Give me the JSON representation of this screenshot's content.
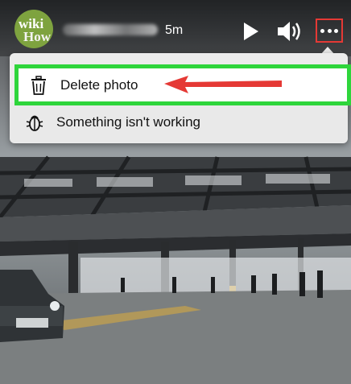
{
  "header": {
    "avatar": {
      "logo_line1": "wiki",
      "logo_line2": "How"
    },
    "time_ago": "5m",
    "controls": [
      {
        "name": "play",
        "icon": "play-icon"
      },
      {
        "name": "volume",
        "icon": "speaker-icon"
      },
      {
        "name": "more",
        "icon": "more-horizontal-icon"
      }
    ]
  },
  "menu": {
    "items": [
      {
        "label": "Delete photo",
        "icon": "trash-icon",
        "highlighted": true
      },
      {
        "label": "Something isn't working",
        "icon": "bug-icon",
        "highlighted": false
      }
    ]
  },
  "colors": {
    "highlight_border": "#2ed53b",
    "annotation_arrow": "#e53935",
    "more_button_outline": "#e53935",
    "menu_background": "#ececec"
  }
}
